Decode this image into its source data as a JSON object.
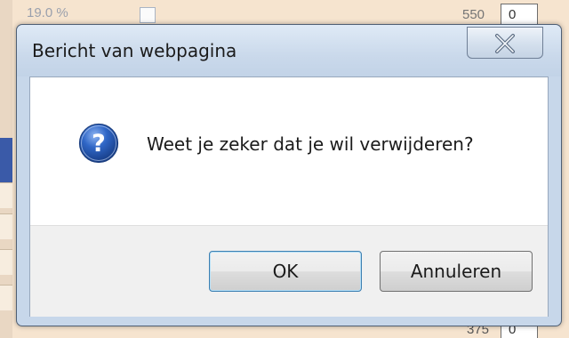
{
  "background": {
    "top_left_text": "19.0 %",
    "top_right_text": "550",
    "top_right_box_value": "0",
    "bottom_right_text": "375",
    "bottom_right_box_value": "0"
  },
  "dialog": {
    "title": "Bericht van webpagina",
    "close_icon": "close-icon",
    "message_icon": "question-icon",
    "message": "Weet je zeker dat je wil verwijderen?",
    "buttons": {
      "ok_label": "OK",
      "cancel_label": "Annuleren"
    }
  },
  "colors": {
    "frame": "#c7d7ea",
    "icon_blue": "#2b62c0",
    "default_button_border": "#3c7fb1"
  }
}
